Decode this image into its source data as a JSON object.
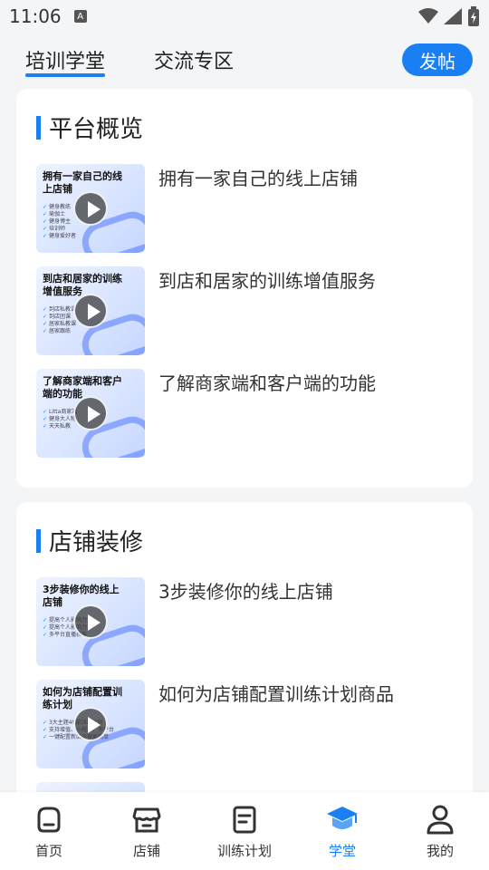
{
  "status": {
    "time": "11:06",
    "badge": "A"
  },
  "top_tabs": [
    {
      "label": "培训学堂"
    },
    {
      "label": "交流专区"
    }
  ],
  "post_button": "发帖",
  "sections": [
    {
      "title": "平台概览",
      "items": [
        {
          "thumb_title": "拥有一家自己的线上店铺",
          "thumb_lines": [
            "健身教练",
            "瑜伽士",
            "健身博主",
            "培训师",
            "健身爱好者"
          ],
          "title": "拥有一家自己的线上店铺"
        },
        {
          "thumb_title": "到店和居家的训练增值服务",
          "thumb_lines": [
            "到店私教课",
            "到店团课",
            "居家私教课",
            "居家跟练"
          ],
          "title": "到店和居家的训练增值服务"
        },
        {
          "thumb_title": "了解商家端和客户端的功能",
          "thumb_lines": [
            "Litta商家端",
            "健身大人物",
            "天天私教"
          ],
          "title": "了解商家端和客户端的功能"
        }
      ]
    },
    {
      "title": "店铺装修",
      "items": [
        {
          "thumb_title": "3步装修你的线上店铺",
          "thumb_lines": [
            "提高个人影响力",
            "提高个人影响力",
            "多平台直播获客"
          ],
          "title": "3步装修你的线上店铺"
        },
        {
          "thumb_title": "如何为店铺配置训练计划",
          "thumb_lines": [
            "3大主题49款训练计划",
            "支持增值、小程序、多平台",
            "一键配置新店运营更简单"
          ],
          "title": "如何为店铺配置训练计划商品"
        }
      ]
    }
  ],
  "bottom_nav": [
    {
      "label": "首页",
      "icon": "home-icon"
    },
    {
      "label": "店铺",
      "icon": "store-icon"
    },
    {
      "label": "训练计划",
      "icon": "plan-icon"
    },
    {
      "label": "学堂",
      "icon": "graduation-cap-icon"
    },
    {
      "label": "我的",
      "icon": "person-icon"
    }
  ],
  "colors": {
    "accent": "#1a7ff2",
    "background": "#f4f5f7"
  }
}
